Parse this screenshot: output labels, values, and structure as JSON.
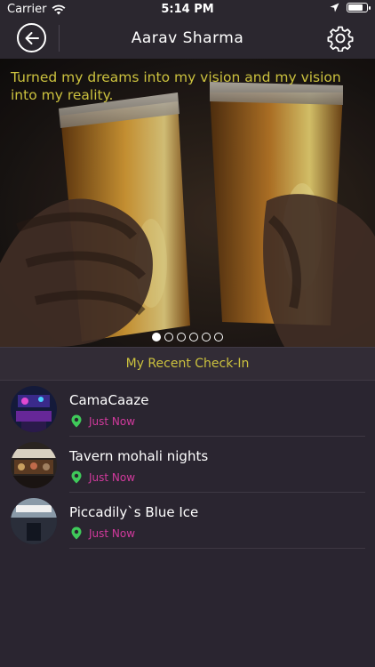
{
  "status_bar": {
    "carrier": "Carrier",
    "time": "5:14 PM",
    "battery_level": 0.85
  },
  "header": {
    "title": "Aarav Sharma"
  },
  "banner": {
    "quote": "Turned my dreams into my vision and my vision into my reality.",
    "page_count": 6,
    "active_page": 1
  },
  "section": {
    "title": "My Recent Check-In"
  },
  "checkins": [
    {
      "name": "CamaCaaze",
      "time": "Just Now"
    },
    {
      "name": "Tavern mohali nights",
      "time": "Just Now"
    },
    {
      "name": "Piccadily`s Blue Ice",
      "time": "Just Now"
    }
  ],
  "colors": {
    "accent_yellow": "#cbc13e",
    "time_pink": "#d23a9d",
    "pin_green": "#3fca5a",
    "background": "#2a2530"
  },
  "icons": {
    "back": "back-arrow-icon",
    "settings": "gear-icon",
    "location": "location-pin-icon"
  }
}
